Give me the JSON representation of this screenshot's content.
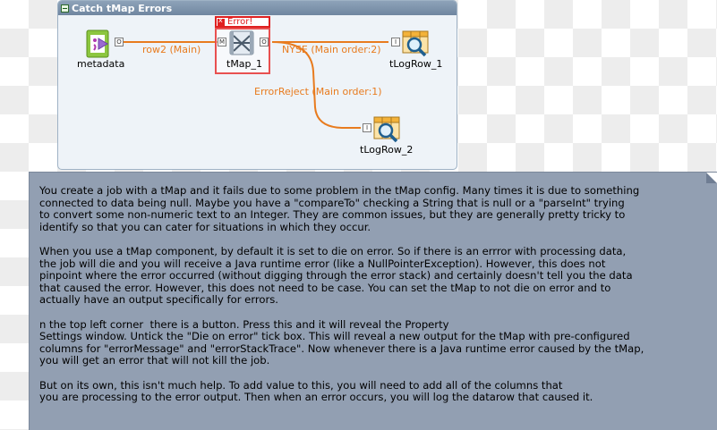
{
  "subjob": {
    "title": "Catch tMap Errors"
  },
  "components": {
    "metadata": {
      "label": "metadata"
    },
    "tmap": {
      "label": "tMap_1",
      "error_badge": "Error!"
    },
    "logrow1": {
      "label": "tLogRow_1"
    },
    "logrow2": {
      "label": "tLogRow_2"
    }
  },
  "connectors": {
    "m": "M",
    "o": "O",
    "i": "I"
  },
  "flows": {
    "row2": "row2 (Main)",
    "nyse": "NYSE (Main order:2)",
    "error_reject": "ErrorReject (Main order:1)"
  },
  "note": {
    "paragraphs": [
      "You create a job with a tMap and it fails due to some problem in the tMap config. Many times it is due to something\nconnected to data being null. Maybe you have a \"compareTo\" checking a String that is null or a \"parseInt\" trying\nto convert some non-numeric text to an Integer. They are common issues, but they are generally pretty tricky to\nidentify so that you can cater for situations in which they occur.",
      "When you use a tMap component, by default it is set to die on error. So if there is an errror with processing data,\nthe job will die and you will receive a Java runtime error (like a NullPointerException). However, this does not\npinpoint where the error occurred (without digging through the error stack) and certainly doesn't tell you the data\nthat caused the error. However, this does not need to be case. You can set the tMap to not die on error and to\nactually have an output specifically for errors.",
      "n the top left corner  there is a button. Press this and it will reveal the Property\nSettings window. Untick the \"Die on error\" tick box. This will reveal a new output for the tMap with pre-configured\ncolumns for \"errorMessage\" and \"errorStackTrace\". Now whenever there is a Java runtime error caused by the tMap,\nyou will get an error that will not kill the job.",
      "But on its own, this isn't much help. To add value to this, you will need to add all of the columns that\nyou are processing to the error output. Then when an error occurs, you will log the datarow that caused it."
    ]
  },
  "colors": {
    "flow": "#e87b1e",
    "error": "#e02020",
    "note_bg": "#929fb2",
    "subjob_header": "#7a90a8"
  }
}
